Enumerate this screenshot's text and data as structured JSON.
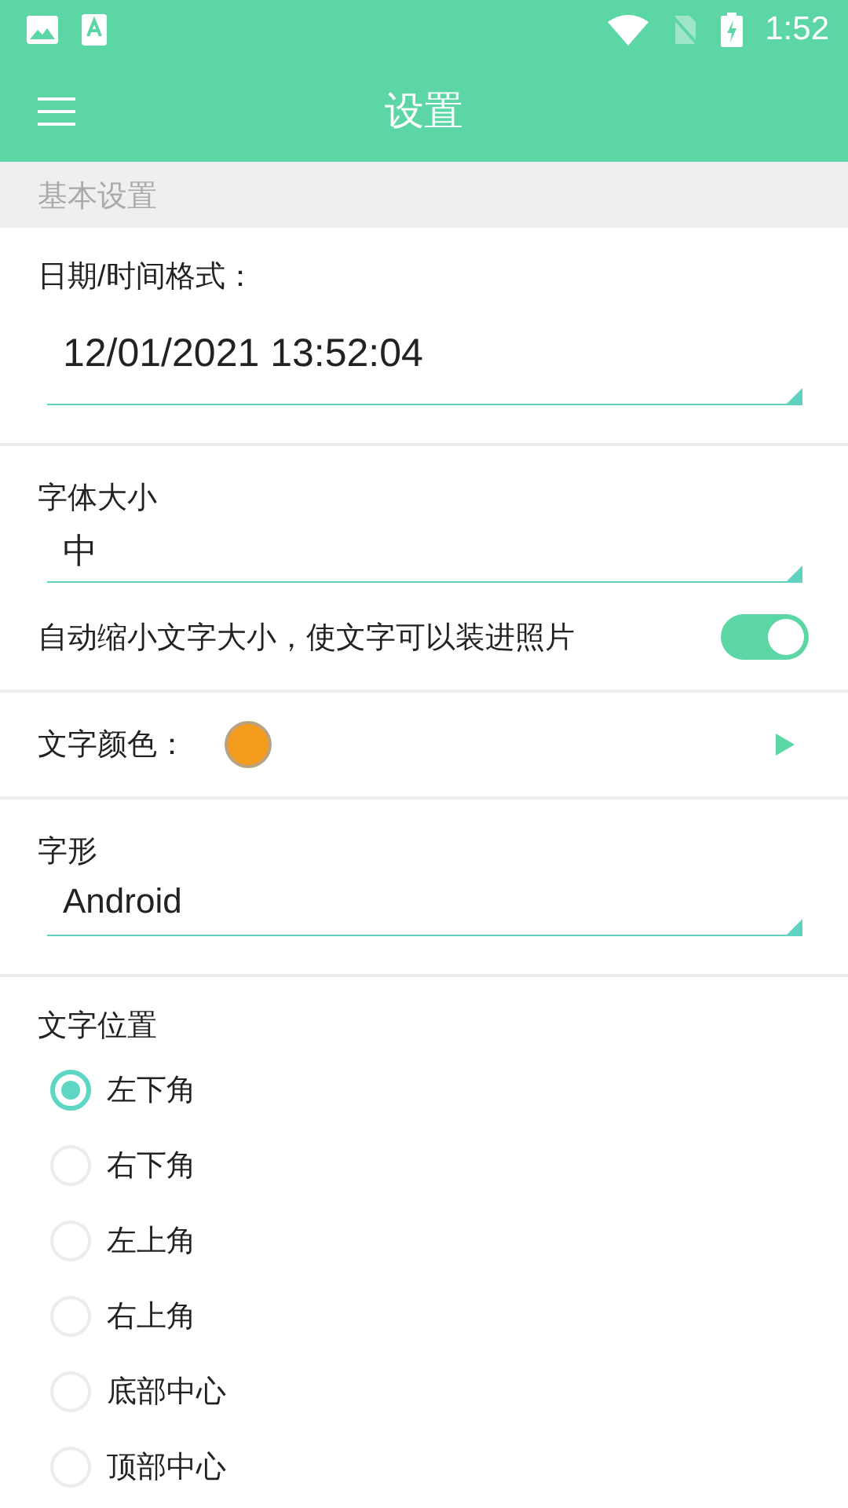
{
  "status_bar": {
    "time": "1:52"
  },
  "toolbar": {
    "title": "设置"
  },
  "section_header": "基本设置",
  "date_format": {
    "label": "日期/时间格式：",
    "value": "12/01/2021 13:52:04"
  },
  "font_size": {
    "label": "字体大小",
    "value": "中"
  },
  "auto_shrink": {
    "label": "自动缩小文字大小，使文字可以装进照片",
    "on": true
  },
  "text_color": {
    "label": "文字颜色：",
    "color": "#f39c1d"
  },
  "font_face": {
    "label": "字形",
    "value": "Android"
  },
  "text_position": {
    "label": "文字位置",
    "options": [
      {
        "label": "左下角",
        "selected": true
      },
      {
        "label": "右下角",
        "selected": false
      },
      {
        "label": "左上角",
        "selected": false
      },
      {
        "label": "右上角",
        "selected": false
      },
      {
        "label": "底部中心",
        "selected": false
      },
      {
        "label": "顶部中心",
        "selected": false
      }
    ]
  }
}
